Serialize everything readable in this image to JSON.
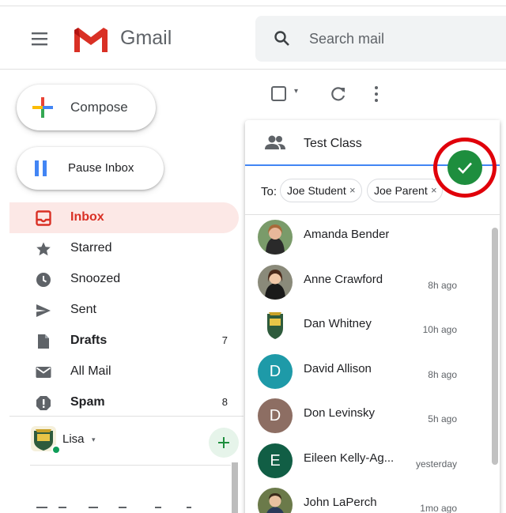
{
  "header": {
    "brand": "Gmail",
    "search_placeholder": "Search mail"
  },
  "sidebar": {
    "compose_label": "Compose",
    "pause_label": "Pause Inbox",
    "items": [
      {
        "label": "Inbox",
        "count": ""
      },
      {
        "label": "Starred",
        "count": ""
      },
      {
        "label": "Snoozed",
        "count": ""
      },
      {
        "label": "Sent",
        "count": ""
      },
      {
        "label": "Drafts",
        "count": "7"
      },
      {
        "label": "All Mail",
        "count": ""
      },
      {
        "label": "Spam",
        "count": "8"
      }
    ]
  },
  "hangouts": {
    "user_name": "Lisa",
    "user_caret": "▾"
  },
  "toolbar": {
    "select_caret": "▾"
  },
  "new_message": {
    "group_name": "Test Class",
    "to_label": "To:",
    "recipients": [
      {
        "name": "Joe Student",
        "remove": "×"
      },
      {
        "name": "Joe Parent",
        "remove": "×"
      }
    ],
    "contacts": [
      {
        "name": "Amanda Bender",
        "time": "",
        "initial": "",
        "color": "#b07a6a"
      },
      {
        "name": "Anne Crawford",
        "time": "8h ago",
        "initial": "",
        "color": "#6a4a3a"
      },
      {
        "name": "Dan Whitney",
        "time": "10h ago",
        "initial": "",
        "color": "#2e5b3c"
      },
      {
        "name": "David Allison",
        "time": "8h ago",
        "initial": "D",
        "color": "#1e9aa8"
      },
      {
        "name": "Don Levinsky",
        "time": "5h ago",
        "initial": "D",
        "color": "#8d6e63"
      },
      {
        "name": "Eileen Kelly-Ag...",
        "time": "yesterday",
        "initial": "E",
        "color": "#115e45"
      },
      {
        "name": "John LaPerch",
        "time": "1mo ago",
        "initial": "",
        "color": "#4a5a3a"
      }
    ]
  },
  "colors": {
    "gmail_red": "#d93025",
    "confirm_green": "#1e8e3e",
    "annotation_ring": "#e0000a",
    "active_bg": "#fce8e6"
  }
}
